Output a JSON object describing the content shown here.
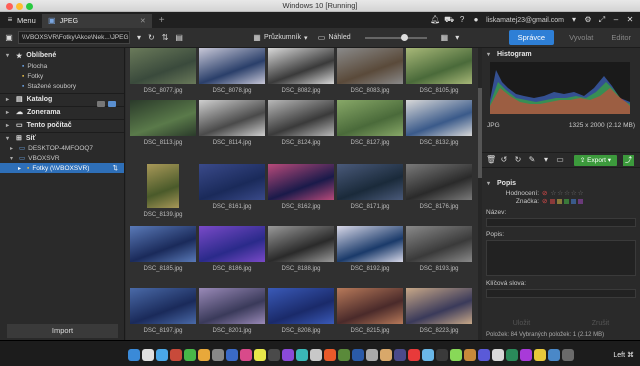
{
  "window": {
    "title": "Windows 10 [Running]"
  },
  "menubar": {
    "menu_label": "Menu",
    "tab_label": "JPEG",
    "user": "liskamatej23@gmail.com"
  },
  "toolbar": {
    "path": "\\\\VBOXSVR\\Fotky\\Akce\\Nek...\\JPEG",
    "explorer_label": "Průzkumník",
    "preview_label": "Náhled",
    "modes": [
      "Správce",
      "Vyvolat",
      "Editor"
    ]
  },
  "left_panel": {
    "favorites_label": "Oblíbené",
    "favorites": [
      "Plocha",
      "Fotky",
      "Stažené soubory"
    ],
    "catalog_label": "Katalog",
    "zonerama_label": "Zonerama",
    "computer_label": "Tento počítač",
    "network_label": "Síť",
    "network_items": [
      "DESKTOP-4MFOOQ7",
      "VBOXSVR"
    ],
    "selected_share": "Fotky (\\\\VBOXSVR)",
    "import_label": "Import"
  },
  "thumbnails": [
    {
      "name": "DSC_8077.jpg",
      "colors": [
        "#3a4a3c",
        "#6a7a5a"
      ]
    },
    {
      "name": "DSC_8078.jpg",
      "colors": [
        "#2a3f6a",
        "#c8c8d8"
      ]
    },
    {
      "name": "DSC_8082.jpg",
      "colors": [
        "#3a3a3a",
        "#d8d8d8"
      ]
    },
    {
      "name": "DSC_8083.jpg",
      "colors": [
        "#5a4a3a",
        "#8a8a8a"
      ]
    },
    {
      "name": "DSC_8105.jpg",
      "colors": [
        "#4a6a3a",
        "#a8b878"
      ]
    },
    {
      "name": "DSC_8113.jpg",
      "colors": [
        "#5a7a4a",
        "#2a3a2a"
      ]
    },
    {
      "name": "DSC_8114.jpg",
      "colors": [
        "#4a4a4a",
        "#cfcfcf"
      ]
    },
    {
      "name": "DSC_8124.jpg",
      "colors": [
        "#3a3a3a",
        "#b8b8b8"
      ]
    },
    {
      "name": "DSC_8127.jpg",
      "colors": [
        "#4a6a3a",
        "#88a868"
      ]
    },
    {
      "name": "DSC_8132.jpg",
      "colors": [
        "#3a5a8a",
        "#d8d8d8"
      ]
    },
    {
      "name": "DSC_8139.jpg",
      "colors": [
        "#4a5a2a",
        "#a89858"
      ]
    },
    {
      "name": "DSC_8161.jpg",
      "colors": [
        "#1a2a5a",
        "#3a4a8a"
      ]
    },
    {
      "name": "DSC_8162.jpg",
      "colors": [
        "#1a1a4a",
        "#b84a7a"
      ]
    },
    {
      "name": "DSC_8171.jpg",
      "colors": [
        "#1a2a3a",
        "#4a5a7a"
      ]
    },
    {
      "name": "DSC_8176.jpg",
      "colors": [
        "#2a2a2a",
        "#7a7a7a"
      ]
    },
    {
      "name": "DSC_8185.jpg",
      "colors": [
        "#1a2a5a",
        "#5a7ab8"
      ]
    },
    {
      "name": "DSC_8186.jpg",
      "colors": [
        "#2a2a8a",
        "#7a4ac8"
      ]
    },
    {
      "name": "DSC_8188.jpg",
      "colors": [
        "#2a2a2a",
        "#9a9a9a"
      ]
    },
    {
      "name": "DSC_8192.jpg",
      "colors": [
        "#1a3a6a",
        "#d8d8e8"
      ]
    },
    {
      "name": "DSC_8193.jpg",
      "colors": [
        "#3a3a3a",
        "#8a8a8a"
      ]
    },
    {
      "name": "DSC_8197.jpg",
      "colors": [
        "#1a2a5a",
        "#4a6aa8"
      ]
    },
    {
      "name": "DSC_8201.jpg",
      "colors": [
        "#3a3a5a",
        "#9a8ab8"
      ]
    },
    {
      "name": "DSC_8208.jpg",
      "colors": [
        "#1a2a6a",
        "#3a5ab8"
      ]
    },
    {
      "name": "DSC_8215.jpg",
      "colors": [
        "#4a2a2a",
        "#b87a5a"
      ]
    },
    {
      "name": "DSC_8223.jpg",
      "colors": [
        "#3a3a5a",
        "#c8a888"
      ]
    }
  ],
  "right_panel": {
    "histogram_label": "Histogram",
    "format": "JPG",
    "dimensions": "1325 x 2000 (2.12 MB)",
    "export_label": "Export",
    "description_label": "Popis",
    "rating_label": "Hodnocení:",
    "flag_label": "Značka:",
    "name_label": "Název:",
    "desc_label": "Popis:",
    "keywords_label": "Klíčová slova:",
    "apply_label": "Uložit",
    "cancel_label": "Zrušit",
    "status": "Položek: 84    Vybraných položek: 1 (2.12 MB)"
  },
  "dock": {
    "keyboard": "Left ⌘"
  }
}
